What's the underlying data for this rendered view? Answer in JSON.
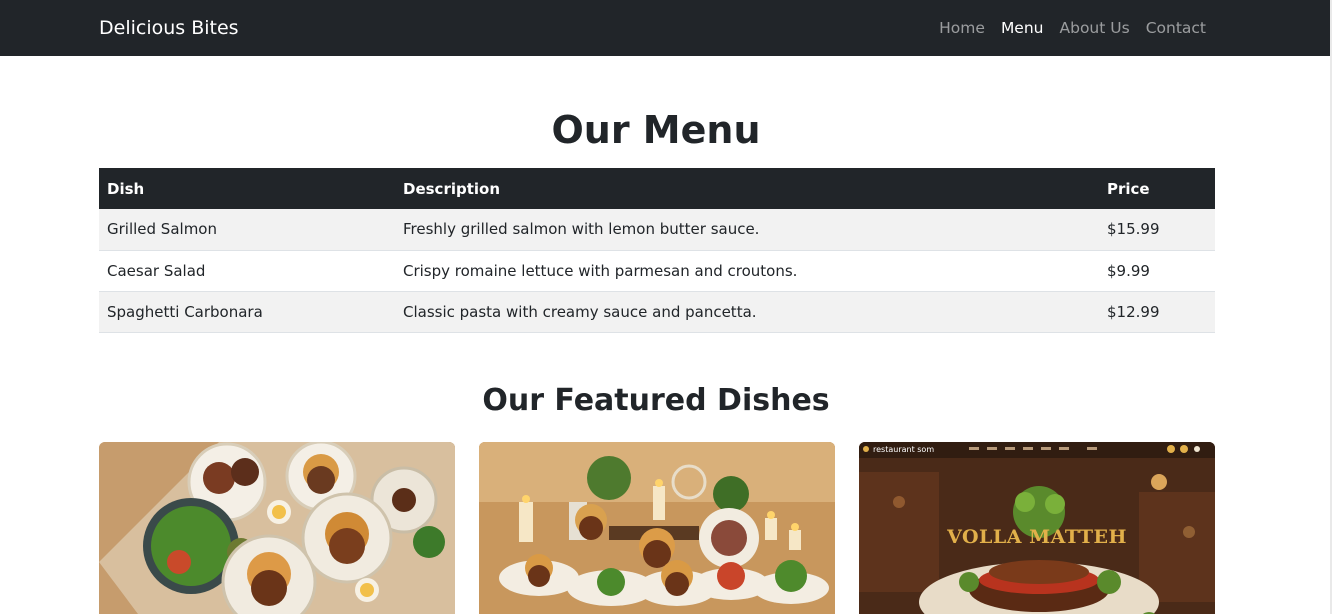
{
  "navbar": {
    "brand": "Delicious Bites",
    "links": [
      {
        "label": "Home",
        "active": false
      },
      {
        "label": "Menu",
        "active": true
      },
      {
        "label": "About Us",
        "active": false
      },
      {
        "label": "Contact",
        "active": false
      }
    ]
  },
  "menu": {
    "title": "Our Menu",
    "headers": [
      "Dish",
      "Description",
      "Price"
    ],
    "rows": [
      [
        "Grilled Salmon",
        "Freshly grilled salmon with lemon butter sauce.",
        "$15.99"
      ],
      [
        "Caesar Salad",
        "Crispy romaine lettuce with parmesan and croutons.",
        "$9.99"
      ],
      [
        "Spaghetti Carbonara",
        "Classic pasta with creamy sauce and pancetta.",
        "$12.99"
      ]
    ]
  },
  "featured": {
    "title": "Our Featured Dishes",
    "cards": [
      {
        "image": "food-table-photo"
      },
      {
        "image": "buffet-candles-photo"
      },
      {
        "image": "restaurant-website-photo",
        "site_label": "restaurant som",
        "hero_text": "VOLLA MATTEH"
      }
    ]
  }
}
